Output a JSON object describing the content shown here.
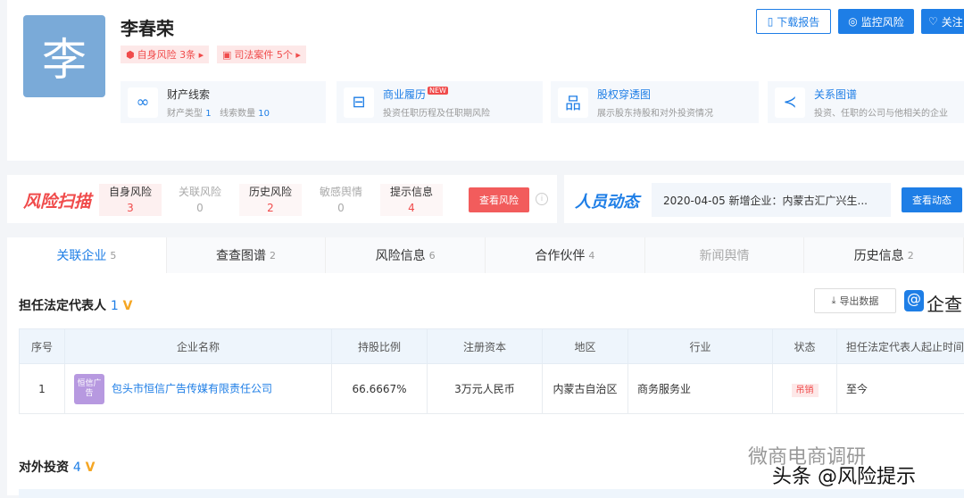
{
  "profile": {
    "avatar_char": "李",
    "name": "李春荣",
    "badges": [
      {
        "label": "自身风险 3条 ▸"
      },
      {
        "label": "司法案件 5个 ▸"
      }
    ]
  },
  "actions": {
    "download": "下载报告",
    "monitor": "监控风险",
    "follow": "关注"
  },
  "features": [
    {
      "title": "财产线索",
      "desc_a": "财产类型",
      "val_a": "1",
      "desc_b": "线索数量",
      "val_b": "10"
    },
    {
      "title": "商业履历",
      "badge": "NEW",
      "desc": "投资任职历程及任职期风险"
    },
    {
      "title": "股权穿透图",
      "desc": "展示股东持股和对外投资情况"
    },
    {
      "title": "关系图谱",
      "desc": "投资、任职的公司与他相关的企业"
    }
  ],
  "risk": {
    "title": "风险扫描",
    "items": [
      {
        "label": "自身风险",
        "count": "3"
      },
      {
        "label": "关联风险",
        "count": "0"
      },
      {
        "label": "历史风险",
        "count": "2"
      },
      {
        "label": "敏感舆情",
        "count": "0"
      },
      {
        "label": "提示信息",
        "count": "4"
      }
    ],
    "button": "查看风险"
  },
  "people": {
    "title": "人员动态",
    "news": "2020-04-05 新增企业：内蒙古汇广兴生...",
    "button": "查看动态"
  },
  "tabs": [
    {
      "label": "关联企业",
      "count": "5"
    },
    {
      "label": "查查图谱",
      "count": "2"
    },
    {
      "label": "风险信息",
      "count": "6"
    },
    {
      "label": "合作伙伴",
      "count": "4"
    },
    {
      "label": "新闻舆情",
      "count": ""
    },
    {
      "label": "历史信息",
      "count": "2"
    }
  ],
  "legal_rep": {
    "title": "担任法定代表人",
    "count": "1",
    "export": "导出数据",
    "brand": "企查",
    "columns": [
      "序号",
      "企业名称",
      "持股比例",
      "注册资本",
      "地区",
      "行业",
      "状态",
      "担任法定代表人起止时间"
    ],
    "rows": [
      {
        "no": "1",
        "logo": "恒信广告",
        "name": "包头市恒信广告传媒有限责任公司",
        "share": "66.6667%",
        "capital": "3万元人民币",
        "region": "内蒙古自治区",
        "industry": "商务服务业",
        "status": "吊销",
        "period": "至今"
      }
    ]
  },
  "investment": {
    "title": "对外投资",
    "count": "4"
  },
  "watermark": {
    "line1": "微商电商调研",
    "line2": "头条 @风险提示"
  }
}
